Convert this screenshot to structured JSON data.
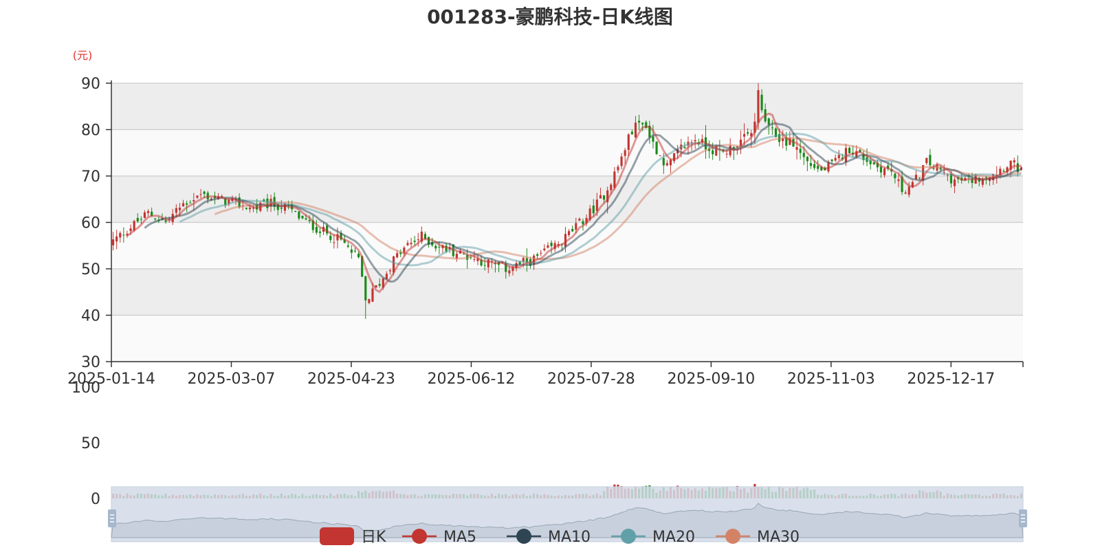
{
  "chart_data": {
    "type": "candlestick",
    "title": "001283-豪鹏科技-日K线图",
    "y_unit": "(元)",
    "ylim": [
      30,
      90
    ],
    "y_ticks": [
      30,
      40,
      50,
      60,
      70,
      80,
      90
    ],
    "volume_ylim": [
      0,
      100
    ],
    "volume_ticks": [
      0,
      50,
      100
    ],
    "x_tick_labels": [
      "2025-01-14",
      "2025-03-07",
      "2025-04-23",
      "2025-06-12",
      "2025-07-28",
      "2025-09-10",
      "2025-11-03",
      "2025-12-17"
    ],
    "legend": [
      "日K",
      "MA5",
      "MA10",
      "MA20",
      "MA30"
    ],
    "colors": {
      "up": "#c23531",
      "down": "#1a8a1a",
      "ma5": "#c23531",
      "ma10": "#2f4554",
      "ma20": "#61a0a8",
      "ma30": "#d48265",
      "plot_band": "#ededed",
      "grid": "#cccccc",
      "slider_fill": "#d2dbe8",
      "slider_handle": "#a7b7cc"
    },
    "close_anchors": [
      [
        0,
        56
      ],
      [
        5,
        59
      ],
      [
        10,
        62
      ],
      [
        15,
        60
      ],
      [
        20,
        64
      ],
      [
        25,
        66
      ],
      [
        30,
        65
      ],
      [
        35,
        64
      ],
      [
        40,
        63
      ],
      [
        45,
        64
      ],
      [
        50,
        63
      ],
      [
        55,
        60
      ],
      [
        60,
        58
      ],
      [
        65,
        56
      ],
      [
        70,
        52
      ],
      [
        72,
        43
      ],
      [
        74,
        45
      ],
      [
        77,
        48
      ],
      [
        80,
        52
      ],
      [
        84,
        55
      ],
      [
        88,
        57
      ],
      [
        92,
        55
      ],
      [
        96,
        54
      ],
      [
        100,
        53
      ],
      [
        104,
        52
      ],
      [
        108,
        51
      ],
      [
        112,
        50
      ],
      [
        116,
        51
      ],
      [
        120,
        52
      ],
      [
        124,
        54
      ],
      [
        128,
        56
      ],
      [
        132,
        59
      ],
      [
        136,
        62
      ],
      [
        140,
        66
      ],
      [
        144,
        72
      ],
      [
        148,
        80
      ],
      [
        151,
        82
      ],
      [
        154,
        77
      ],
      [
        158,
        72
      ],
      [
        162,
        76
      ],
      [
        166,
        78
      ],
      [
        170,
        76
      ],
      [
        174,
        75
      ],
      [
        178,
        77
      ],
      [
        182,
        79
      ],
      [
        184,
        86
      ],
      [
        187,
        80
      ],
      [
        190,
        78
      ],
      [
        194,
        77
      ],
      [
        198,
        73
      ],
      [
        202,
        71
      ],
      [
        206,
        73
      ],
      [
        210,
        76
      ],
      [
        214,
        74
      ],
      [
        218,
        72
      ],
      [
        222,
        71
      ],
      [
        225,
        67
      ],
      [
        228,
        68
      ],
      [
        232,
        73
      ],
      [
        236,
        71
      ],
      [
        240,
        69
      ],
      [
        244,
        69
      ],
      [
        248,
        70
      ],
      [
        252,
        71
      ],
      [
        256,
        73
      ],
      [
        259,
        71
      ]
    ],
    "volume_peak_day": 183
  }
}
